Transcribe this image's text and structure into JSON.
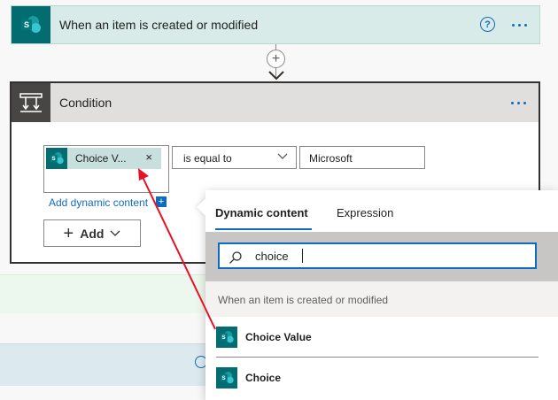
{
  "trigger": {
    "title": "When an item is created or modified",
    "icon": "sharepoint-icon",
    "badge_color": "#036c70",
    "help_glyph": "?"
  },
  "connector": {
    "plus_glyph": "+"
  },
  "condition": {
    "title": "Condition",
    "icon": "condition-icon",
    "token": {
      "label": "Choice V...",
      "close_glyph": "×"
    },
    "add_dynamic_link": "Add dynamic content",
    "add_dynamic_glyph": "+",
    "operator": {
      "selected": "is equal to"
    },
    "value": "Microsoft",
    "add_button": {
      "plus_glyph": "+",
      "label": "Add"
    }
  },
  "dynamic_panel": {
    "tabs": [
      {
        "label": "Dynamic content",
        "active": true
      },
      {
        "label": "Expression",
        "active": false
      }
    ],
    "search": {
      "value": "choice"
    },
    "group_header": "When an item is created or modified",
    "results": [
      {
        "label": "Choice Value",
        "icon": "sharepoint-icon"
      },
      {
        "label": "Choice",
        "icon": "sharepoint-icon"
      }
    ]
  },
  "colors": {
    "accent": "#0f6cbd",
    "sharepoint": "#036c70",
    "trigger_bg": "#d8ebe8",
    "condition_header": "#e1dfdd",
    "annotation_arrow": "#e81123"
  }
}
